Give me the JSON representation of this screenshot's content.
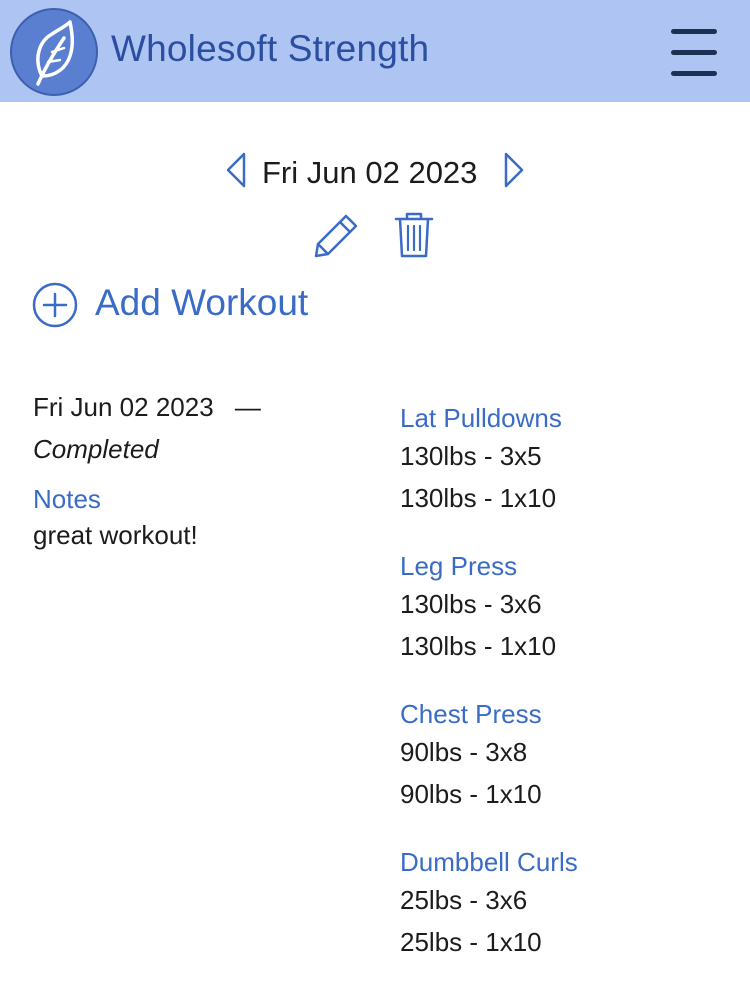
{
  "header": {
    "app_title": "Wholesoft Strength",
    "logo_icon": "leaf-icon",
    "menu_icon": "hamburger-menu-icon",
    "background_color": "#aec5f3",
    "title_color": "#2c4ea0"
  },
  "date_nav": {
    "current_date": "Fri Jun 02 2023",
    "prev_icon": "chevron-left-icon",
    "next_icon": "chevron-right-icon",
    "edit_icon": "pencil-icon",
    "delete_icon": "trash-icon"
  },
  "add_workout": {
    "label": "Add Workout",
    "icon": "plus-circle-icon",
    "accent_color": "#3a6cc6"
  },
  "workout": {
    "date": "Fri Jun 02 2023",
    "separator": "—",
    "status": "Completed",
    "notes_heading": "Notes",
    "notes_text": "great workout!",
    "exercises": [
      {
        "name": "Lat Pulldowns",
        "sets": [
          "130lbs - 3x5",
          "130lbs - 1x10"
        ]
      },
      {
        "name": "Leg Press",
        "sets": [
          "130lbs - 3x6",
          "130lbs - 1x10"
        ]
      },
      {
        "name": "Chest Press",
        "sets": [
          "90lbs - 3x8",
          "90lbs - 1x10"
        ]
      },
      {
        "name": "Dumbbell Curls",
        "sets": [
          "25lbs - 3x6",
          "25lbs - 1x10"
        ]
      }
    ]
  }
}
